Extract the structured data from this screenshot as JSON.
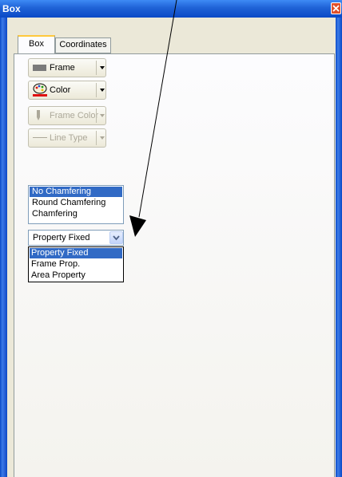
{
  "window": {
    "title": "Box"
  },
  "tabs": [
    {
      "label": "Box",
      "active": true
    },
    {
      "label": "Coordinates",
      "active": false
    }
  ],
  "toolbar": {
    "frame_label": "Frame",
    "color_label": "Color",
    "frame_color_label": "Frame Color",
    "line_type_label": "Line Type"
  },
  "chamfer_list": {
    "items": [
      "No Chamfering",
      "Round Chamfering",
      "Chamfering"
    ],
    "selected": "No Chamfering"
  },
  "property_combo": {
    "value": "Property Fixed",
    "options": [
      "Property Fixed",
      "Frame Prop.",
      "Area Property"
    ],
    "highlighted": "Property Fixed"
  },
  "colors": {
    "titlebar": "#0a49c6",
    "selection": "#316ac5",
    "active_tab_accent": "#ffc83c",
    "close_button": "#e0502a"
  }
}
